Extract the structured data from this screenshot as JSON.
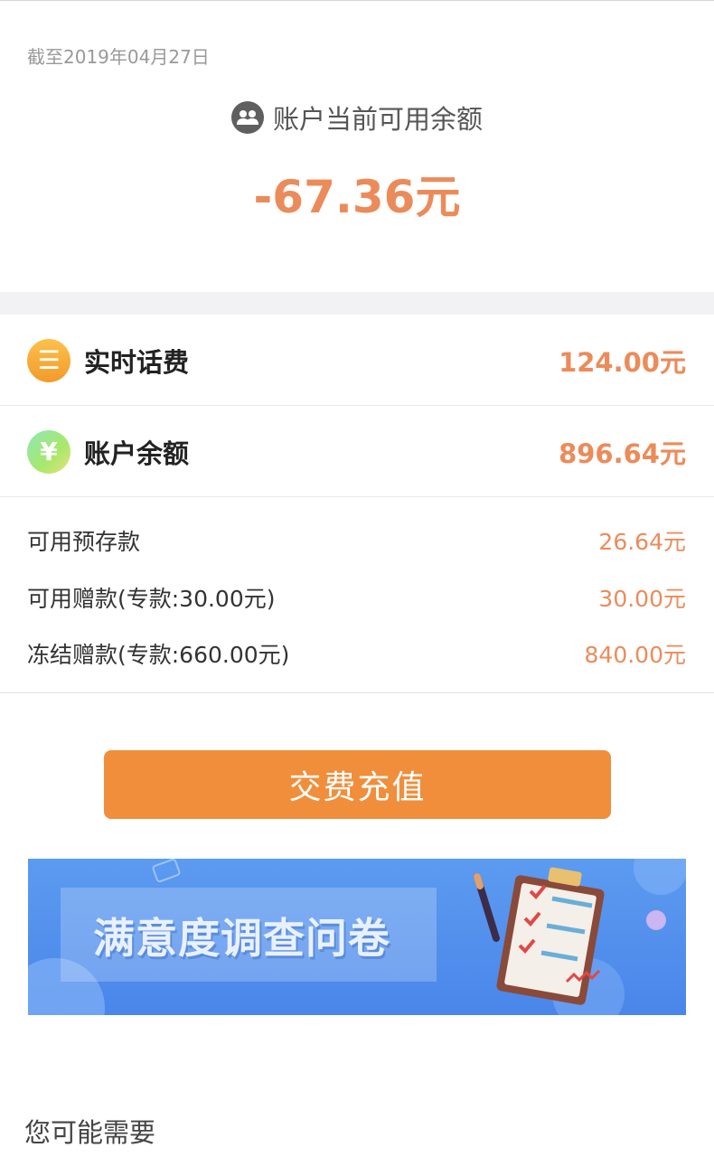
{
  "header": {
    "as_of_date": "截至2019年04月27日",
    "available_label": "账户当前可用余额",
    "available_amount": "-67.36元",
    "icon": "users-icon"
  },
  "summary_rows": [
    {
      "icon": "list-coin-icon",
      "icon_glyph": "☰",
      "title": "实时话费",
      "value": "124.00元"
    },
    {
      "icon": "yuan-coin-icon",
      "icon_glyph": "¥",
      "title": "账户余额",
      "value": "896.64元"
    }
  ],
  "detail_rows": [
    {
      "label": "可用预存款",
      "value": "26.64元"
    },
    {
      "label": "可用赠款(专款:30.00元)",
      "value": "30.00元"
    },
    {
      "label": "冻结赠款(专款:660.00元)",
      "value": "840.00元"
    }
  ],
  "pay_button": {
    "label": "交费充值"
  },
  "survey_banner": {
    "text": "满意度调查问卷",
    "icon": "clipboard-checklist-icon"
  },
  "footer": {
    "section_title": "您可能需要"
  },
  "colors": {
    "accent_amount": "#ec8b5a",
    "button": "#f08e3b",
    "banner_blue": "#4a86ea",
    "divider_band": "#f2f2f5"
  }
}
